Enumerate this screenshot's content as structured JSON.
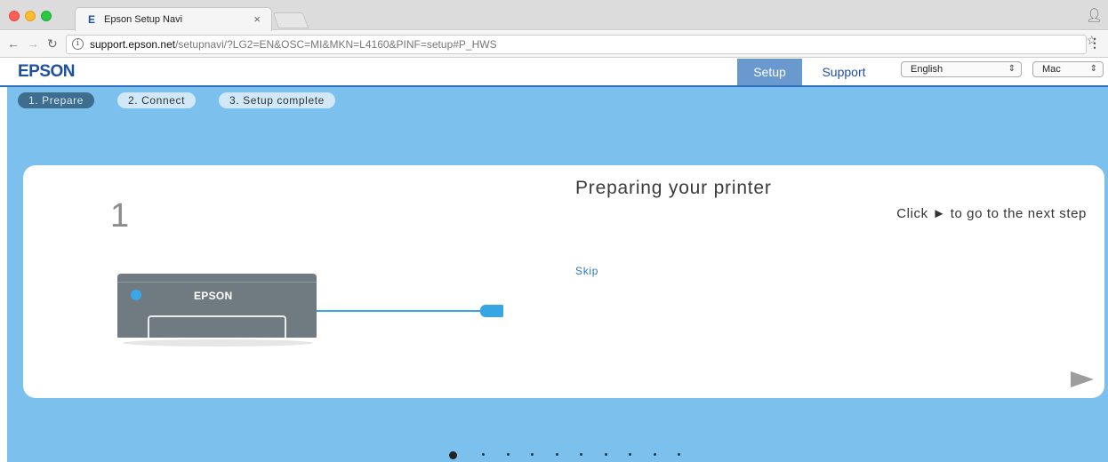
{
  "browser": {
    "tab_favicon": "E",
    "tab_title": "Epson Setup Navi",
    "tab_close": "×",
    "url_host": "support.epson.net",
    "url_path": "/setupnavi/?LG2=EN&OSC=MI&MKN=L4160&PINF=setup#P_HWS",
    "icons": [
      "back-arrow-icon",
      "forward-arrow-icon",
      "reload-icon",
      "info-icon",
      "star-icon",
      "menu-icon",
      "profile-icon"
    ]
  },
  "header": {
    "logo": "EPSON",
    "tabs": [
      {
        "label": "Setup",
        "active": true
      },
      {
        "label": "Support",
        "active": false
      }
    ],
    "language": {
      "selected": "English"
    },
    "os": {
      "selected": "Mac"
    }
  },
  "steps": [
    {
      "label": "1. Prepare",
      "active": true
    },
    {
      "label": "2. Connect",
      "active": false
    },
    {
      "label": "3. Setup complete",
      "active": false
    }
  ],
  "card": {
    "step_number": "1",
    "title": "Preparing your printer",
    "hint": "Click ► to go to the next step",
    "skip_label": "Skip",
    "printer_brand": "EPSON"
  },
  "pagination": {
    "total": 10,
    "current": 1
  },
  "colors": {
    "brand": "#1d4fa3",
    "accent": "#37a6e4",
    "stage_bg": "#7cc0ee",
    "active_step": "#3e6d8e"
  }
}
